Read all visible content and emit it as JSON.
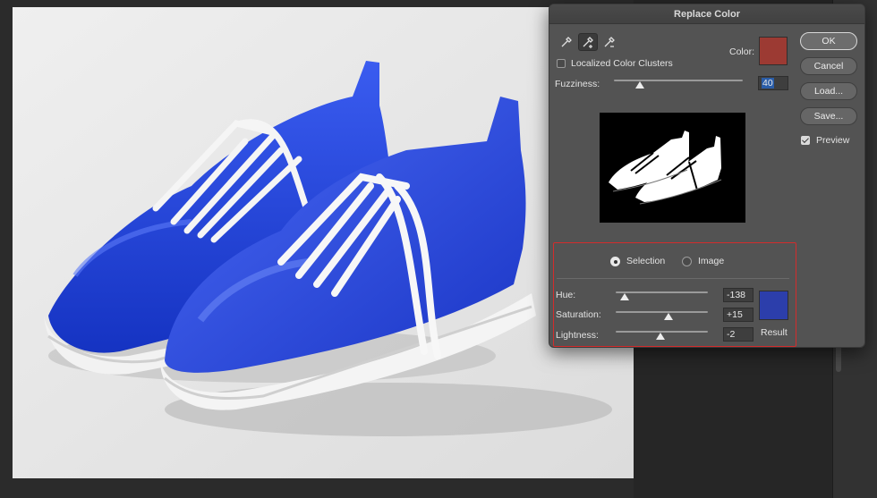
{
  "dialog": {
    "title": "Replace Color",
    "color_label": "Color:",
    "color_swatch": "#9c3a33",
    "localized_label": "Localized Color Clusters",
    "localized_checked": false,
    "fuzziness_label": "Fuzziness:",
    "fuzziness_value": "40",
    "fuzziness_level": 0.2,
    "preview_mode": {
      "selection_label": "Selection",
      "image_label": "Image",
      "selected": "Selection"
    },
    "hue": {
      "label": "Hue:",
      "value": "-138",
      "level": 0.1
    },
    "saturation": {
      "label": "Saturation:",
      "value": "+15",
      "level": 0.57
    },
    "lightness": {
      "label": "Lightness:",
      "value": "-2",
      "level": 0.49
    },
    "result_label": "Result",
    "result_swatch": "#2c3eab",
    "buttons": {
      "ok": "OK",
      "cancel": "Cancel",
      "load": "Load...",
      "save": "Save..."
    },
    "preview_label": "Preview",
    "preview_checked": true,
    "eyedroppers": [
      "eyedropper-icon",
      "eyedropper-plus-icon",
      "eyedropper-minus-icon"
    ]
  },
  "colors": {
    "shoe_blue": "#1f3fd0",
    "highlight": "#d32c2c"
  }
}
